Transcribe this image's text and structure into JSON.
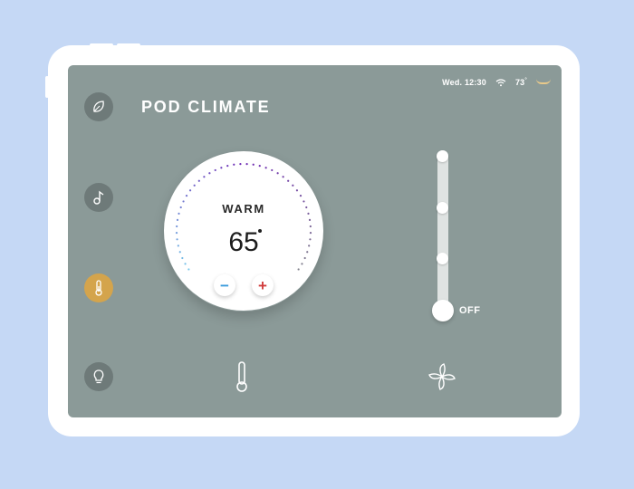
{
  "status": {
    "day_time": "Wed. 12:30",
    "temperature": "73",
    "temperature_unit": "°"
  },
  "app": {
    "title": "POD CLIMATE"
  },
  "sidebar": {
    "items": [
      {
        "name": "leaf-icon",
        "active": false
      },
      {
        "name": "music-note-icon",
        "active": false
      },
      {
        "name": "thermometer-icon",
        "active": true
      },
      {
        "name": "lightbulb-icon",
        "active": false
      }
    ]
  },
  "thermostat": {
    "mode": "WARM",
    "temperature": "65",
    "decrease_label": "−",
    "increase_label": "+"
  },
  "fan": {
    "state_label": "OFF",
    "levels": 4,
    "current_level": 0
  },
  "bottom_tabs": [
    {
      "name": "thermometer-tab-icon"
    },
    {
      "name": "fan-tab-icon"
    }
  ],
  "colors": {
    "background": "#c5d8f5",
    "screen": "#8b9a98",
    "active_accent": "#d4a44c",
    "minus": "#3a9bdc",
    "plus": "#d13c3c"
  }
}
